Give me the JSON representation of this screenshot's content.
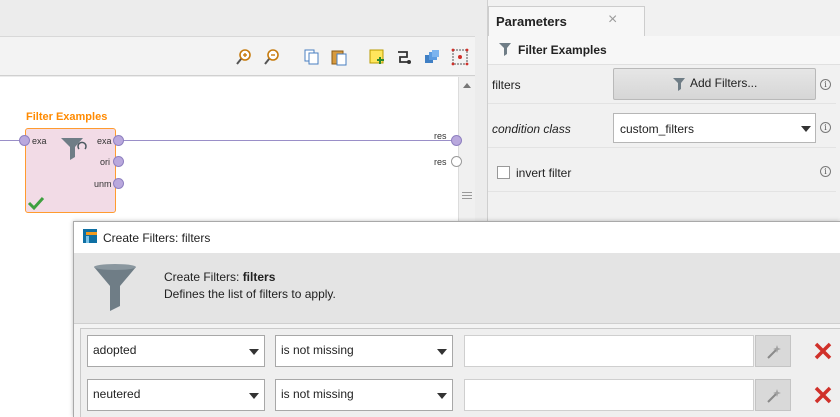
{
  "canvas": {
    "operator": {
      "title": "Filter Examples",
      "input_ports": [
        "exa"
      ],
      "output_ports": [
        "exa",
        "ori",
        "unm"
      ]
    },
    "result_ports": [
      "res",
      "res"
    ]
  },
  "params": {
    "tab_title": "Parameters",
    "close_glyph": "×",
    "operator_name": "Filter Examples",
    "rows": {
      "filters_label": "filters",
      "add_filters_label": "Add Filters...",
      "condition_label": "condition class",
      "condition_value": "custom_filters",
      "invert_label": "invert filter"
    },
    "info_glyph": "i"
  },
  "dialog": {
    "title": "Create Filters: filters",
    "head_prefix": "Create Filters: ",
    "head_bold": "filters",
    "head_desc": "Defines the list of filters to apply.",
    "rows": [
      {
        "attribute": "adopted",
        "operator": "is not missing",
        "value": ""
      },
      {
        "attribute": "neutered",
        "operator": "is not missing",
        "value": ""
      }
    ]
  },
  "colors": {
    "accent_orange": "#ff8a00",
    "port_purple": "#b9a8dd",
    "check_green": "#3fa03f",
    "delete_red": "#d0302a"
  }
}
